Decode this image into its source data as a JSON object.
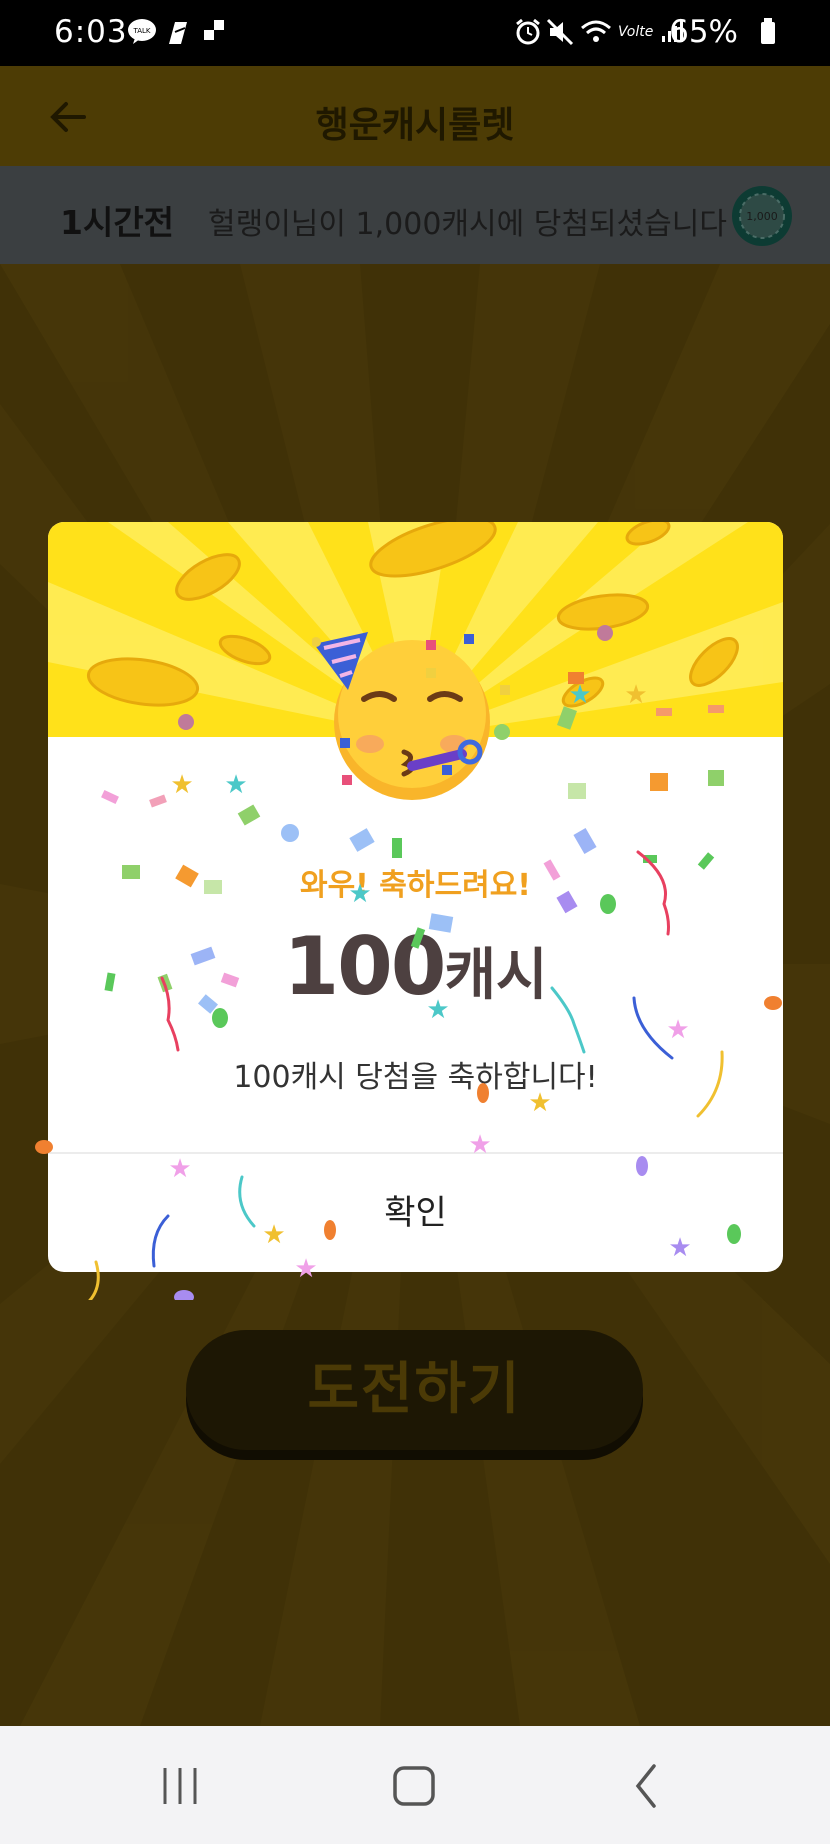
{
  "status_bar": {
    "time": "6:03",
    "battery_text": "65%",
    "icons": [
      "kakaotalk-icon",
      "notification-icon",
      "app-icon",
      "alarm-icon",
      "mute-icon",
      "wifi-icon",
      "volte-icon",
      "signal-icon",
      "battery-icon"
    ]
  },
  "app_bar": {
    "title": "행운캐시룰렛",
    "back_icon": "back-arrow-icon"
  },
  "ticker": {
    "when": "1시간전",
    "message": "헐랭이님이 1,000캐시에 당첨되셨습니다",
    "coin_label": "1,000"
  },
  "challenge_button": {
    "label": "도전하기"
  },
  "dialog": {
    "subtitle": "와우! 축하드려요!",
    "amount_number": "100",
    "amount_unit": "캐시",
    "description": "100캐시 당첨을 축하합니다!",
    "confirm_label": "확인",
    "emoji": "partying-face-icon"
  },
  "nav_bar": {
    "recent_icon": "recent-apps-icon",
    "home_icon": "home-icon",
    "back_icon": "nav-back-icon"
  },
  "colors": {
    "dialog_header": "#ffe11a",
    "subtitle": "#f0a01f",
    "amount": "#4d4040",
    "overlay_bg": "#403107"
  }
}
